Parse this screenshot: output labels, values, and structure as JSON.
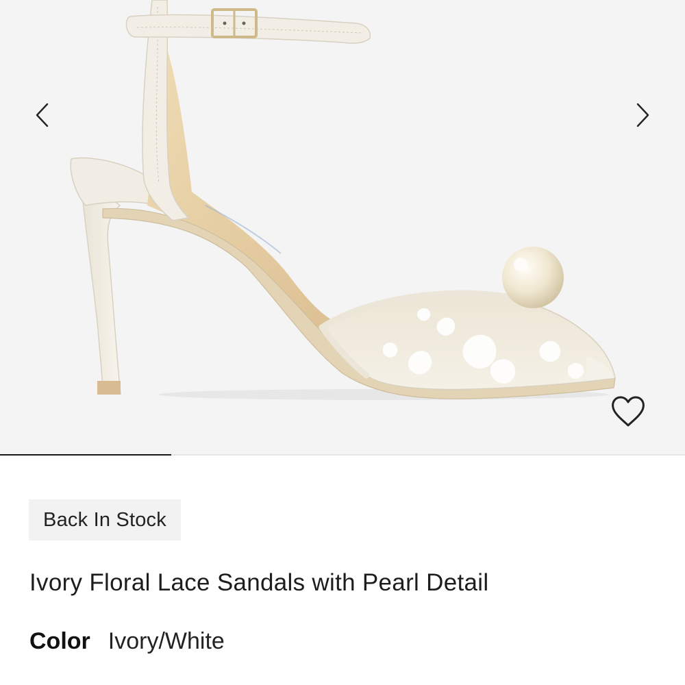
{
  "gallery": {
    "image_alt": "Ivory floral lace sandal with pearl detail and ankle strap",
    "prev_icon": "chevron-left-icon",
    "next_icon": "chevron-right-icon",
    "wishlist_icon": "heart-outline-icon",
    "slide_progress": 0.25
  },
  "product": {
    "badge": "Back In Stock",
    "title": "Ivory Floral Lace Sandals with Pearl Detail",
    "color_label": "Color",
    "color_value": "Ivory/White"
  },
  "colors": {
    "gallery_bg": "#f4f4f4",
    "leather": "#efeae0",
    "lining": "#e8d3a8",
    "pearl": "#efe6cf",
    "text": "#1a1a1a",
    "badge_bg": "#f2f2f2"
  }
}
